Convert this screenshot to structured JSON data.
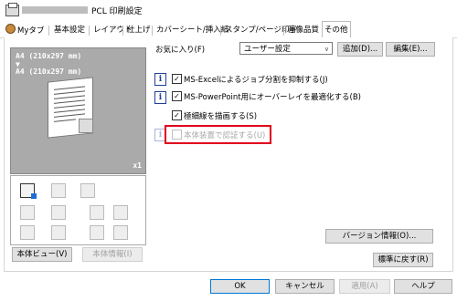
{
  "window": {
    "title": "PCL 印刷設定"
  },
  "tabs": [
    {
      "label": "Myタブ"
    },
    {
      "label": "基本設定"
    },
    {
      "label": "レイアウト"
    },
    {
      "label": "仕上げ"
    },
    {
      "label": "カバーシート/挿入紙"
    },
    {
      "label": "スタンプ/ページ印字"
    },
    {
      "label": "画像品質"
    },
    {
      "label": "その他"
    }
  ],
  "preview": {
    "paper_line1": "A4 (210x297 mm)",
    "arrow": "▼",
    "paper_line2": "A4 (210x297 mm)",
    "copies": "x1"
  },
  "left_buttons": {
    "device_view": "本体ビュー(V)",
    "device_info": "本体情報(I)"
  },
  "favorites": {
    "label": "お気に入り(F)",
    "value": "ユーザー設定",
    "add": "追加(D)...",
    "edit": "編集(E)..."
  },
  "options": [
    {
      "label": "MS-Excelによるジョブ分割を抑制する(J)",
      "checked": true,
      "enabled": true
    },
    {
      "label": "MS-PowerPoint用にオーバーレイを最適化する(B)",
      "checked": true,
      "enabled": true
    },
    {
      "label": "極細線を描画する(S)",
      "checked": true,
      "enabled": true
    },
    {
      "label": "本体装置で認証する(U)",
      "checked": false,
      "enabled": false
    }
  ],
  "buttons": {
    "version_info": "バージョン情報(O)...",
    "restore_default": "標準に戻す(R)",
    "ok": "OK",
    "cancel": "キャンセル",
    "apply": "適用(A)",
    "help": "ヘルプ"
  },
  "colors": {
    "highlight": "#e0001b",
    "accent": "#0078d7"
  }
}
